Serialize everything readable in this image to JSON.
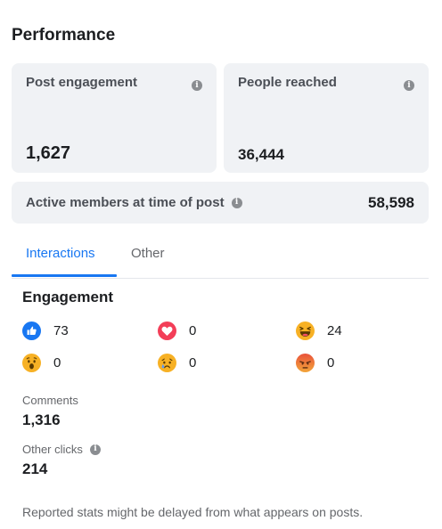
{
  "section_title": "Performance",
  "cards": {
    "post_engagement": {
      "label": "Post engagement",
      "value": "1,627",
      "icon": "info-icon"
    },
    "people_reached": {
      "label": "People reached",
      "value": "36,444",
      "icon": "info-icon"
    }
  },
  "active_members": {
    "label": "Active members at time of post",
    "value": "58,598",
    "icon": "info-icon"
  },
  "tabs": [
    {
      "label": "Interactions",
      "active": true
    },
    {
      "label": "Other",
      "active": false
    }
  ],
  "engagement": {
    "title": "Engagement",
    "reactions": [
      {
        "name": "like",
        "icon": "like-icon",
        "count": "73"
      },
      {
        "name": "love",
        "icon": "love-icon",
        "count": "0"
      },
      {
        "name": "haha",
        "icon": "haha-icon",
        "count": "24"
      },
      {
        "name": "wow",
        "icon": "wow-icon",
        "count": "0"
      },
      {
        "name": "sad",
        "icon": "sad-icon",
        "count": "0"
      },
      {
        "name": "angry",
        "icon": "angry-icon",
        "count": "0"
      }
    ]
  },
  "stats": {
    "comments": {
      "label": "Comments",
      "value": "1,316"
    },
    "other_clicks": {
      "label": "Other clicks",
      "value": "214",
      "icon": "info-icon"
    }
  },
  "footer_note": "Reported stats might be delayed from what appears on posts.",
  "colors": {
    "accent": "#1877f2",
    "card_bg": "#f0f2f5",
    "muted_text": "#65676b"
  }
}
